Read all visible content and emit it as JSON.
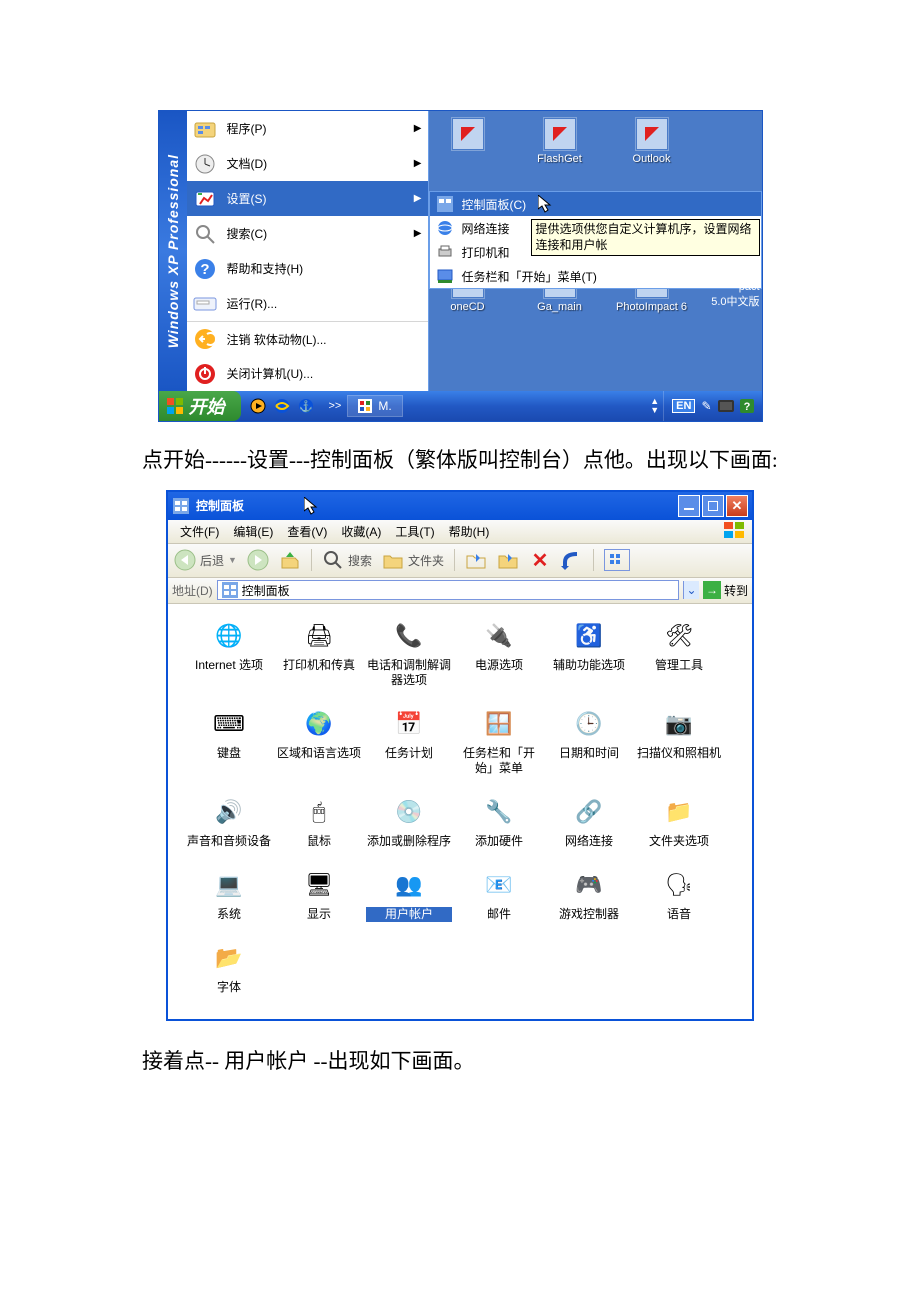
{
  "screenshot1": {
    "brand": "Windows XP Professional",
    "start_menu": [
      {
        "icon": "programs-icon",
        "label": "程序(P)",
        "has_arrow": true,
        "selected": false,
        "sep": false
      },
      {
        "icon": "documents-icon",
        "label": "文档(D)",
        "has_arrow": true,
        "selected": false,
        "sep": false
      },
      {
        "icon": "settings-icon",
        "label": "设置(S)",
        "has_arrow": true,
        "selected": true,
        "sep": false
      },
      {
        "icon": "search-icon",
        "label": "搜索(C)",
        "has_arrow": true,
        "selected": false,
        "sep": false
      },
      {
        "icon": "help-icon",
        "label": "帮助和支持(H)",
        "has_arrow": false,
        "selected": false,
        "sep": false
      },
      {
        "icon": "run-icon",
        "label": "运行(R)...",
        "has_arrow": false,
        "selected": false,
        "sep": false
      },
      {
        "icon": "logoff-icon",
        "label": "注销 软体动物(L)...",
        "has_arrow": false,
        "selected": false,
        "sep": true
      },
      {
        "icon": "shutdown-icon",
        "label": "关闭计算机(U)...",
        "has_arrow": false,
        "selected": false,
        "sep": false
      }
    ],
    "desktop_row1": [
      {
        "label": ""
      },
      {
        "label": "FlashGet"
      },
      {
        "label": "Outlook"
      }
    ],
    "settings_submenu": [
      {
        "icon": "control-panel-icon",
        "label": "控制面板(C)",
        "selected": true
      },
      {
        "icon": "network-icon",
        "label": "网络连接",
        "selected": false
      },
      {
        "icon": "printers-icon",
        "label": "打印机和",
        "selected": false
      },
      {
        "icon": "taskbar-icon",
        "label": "任务栏和「开始」菜单(T)",
        "selected": false
      }
    ],
    "tooltip": "提供选项供您自定义计算机序，设置网络连接和用户帐",
    "pact_label": "pact",
    "pact_ver": "5.0中文版",
    "desktop_row2": [
      {
        "label": "oneCD"
      },
      {
        "label": "Ga_main"
      },
      {
        "label": "PhotoImpact 6"
      }
    ],
    "taskbar": {
      "start": "开始",
      "task_app": "M.",
      "lang": "EN",
      "chevron": ">>"
    }
  },
  "instructions": {
    "line1": "点开始------设置---控制面板（繁体版叫控制台）点他。出现以下画面:",
    "line2": "接着点-- 用户帐户 --出现如下画面。"
  },
  "cp": {
    "title": "控制面板",
    "menus": [
      {
        "label": "文件(F)"
      },
      {
        "label": "编辑(E)"
      },
      {
        "label": "查看(V)"
      },
      {
        "label": "收藏(A)"
      },
      {
        "label": "工具(T)"
      },
      {
        "label": "帮助(H)"
      }
    ],
    "toolbar": {
      "back": "后退",
      "search": "搜索",
      "folders": "文件夹"
    },
    "address": {
      "label": "地址(D)",
      "value": "控制面板",
      "go": "转到"
    },
    "items": [
      {
        "icon": "🌐",
        "label": "Internet 选项"
      },
      {
        "icon": "🖨",
        "label": "打印机和传真"
      },
      {
        "icon": "📞",
        "label": "电话和调制解调器选项"
      },
      {
        "icon": "🔌",
        "label": "电源选项"
      },
      {
        "icon": "♿",
        "label": "辅助功能选项"
      },
      {
        "icon": "🛠",
        "label": "管理工具"
      },
      {
        "icon": "⌨",
        "label": "键盘"
      },
      {
        "icon": "🌍",
        "label": "区域和语言选项"
      },
      {
        "icon": "📅",
        "label": "任务计划"
      },
      {
        "icon": "🪟",
        "label": "任务栏和「开始」菜单"
      },
      {
        "icon": "🕒",
        "label": "日期和时间"
      },
      {
        "icon": "📷",
        "label": "扫描仪和照相机"
      },
      {
        "icon": "🔊",
        "label": "声音和音频设备"
      },
      {
        "icon": "🖱",
        "label": "鼠标"
      },
      {
        "icon": "💿",
        "label": "添加或删除程序"
      },
      {
        "icon": "🔧",
        "label": "添加硬件"
      },
      {
        "icon": "🔗",
        "label": "网络连接"
      },
      {
        "icon": "📁",
        "label": "文件夹选项"
      },
      {
        "icon": "💻",
        "label": "系统"
      },
      {
        "icon": "🖥",
        "label": "显示"
      },
      {
        "icon": "👥",
        "label": "用户帐户",
        "selected": true
      },
      {
        "icon": "📧",
        "label": "邮件"
      },
      {
        "icon": "🎮",
        "label": "游戏控制器"
      },
      {
        "icon": "🗣",
        "label": "语音"
      },
      {
        "icon": "📂",
        "label": "字体"
      }
    ]
  }
}
